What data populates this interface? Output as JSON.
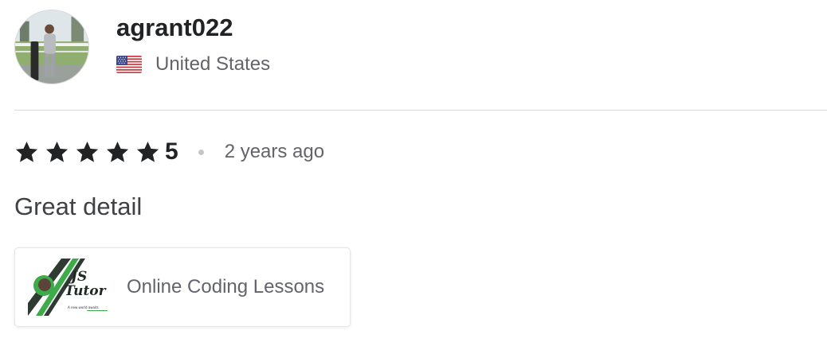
{
  "review": {
    "username": "agrant022",
    "country": "United States",
    "country_flag_icon": "us-flag-icon",
    "rating": {
      "stars": 5,
      "max_stars": 5,
      "value_label": "5",
      "star_color": "#222325"
    },
    "time_ago": "2 years ago",
    "text": "Great detail",
    "gig": {
      "thumb_title": "JS Tutor",
      "thumb_tagline": "A new world awaits",
      "title": "Online Coding Lessons",
      "accent_color": "#3dab4a"
    }
  }
}
